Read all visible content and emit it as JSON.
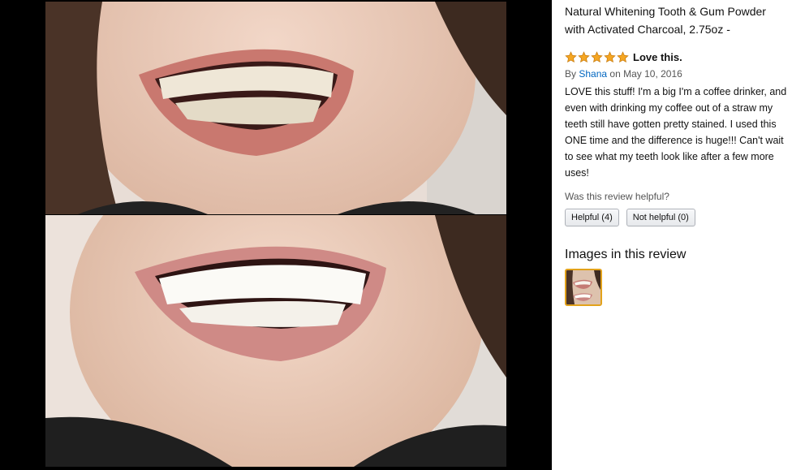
{
  "product": {
    "title": "Natural Whitening Tooth & Gum Powder with Activated Charcoal, 2.75oz -"
  },
  "review": {
    "rating": 5,
    "title": "Love this.",
    "by_prefix": "By",
    "author": "Shana",
    "date": "on May 10, 2016",
    "body": "LOVE this stuff! I'm a big I'm a coffee drinker, and even with drinking my coffee out of a straw my teeth still have gotten pretty stained. I used this ONE time and the difference is huge!!! Can't wait to see what my teeth look like after a few more uses!",
    "helpful_question": "Was this review helpful?",
    "helpful_label": "Helpful (4)",
    "not_helpful_label": "Not helpful (0)"
  },
  "images_section": {
    "heading": "Images in this review"
  },
  "colors": {
    "star": "#f5a623",
    "link": "#0066c0",
    "thumb_border": "#e2a21b"
  }
}
